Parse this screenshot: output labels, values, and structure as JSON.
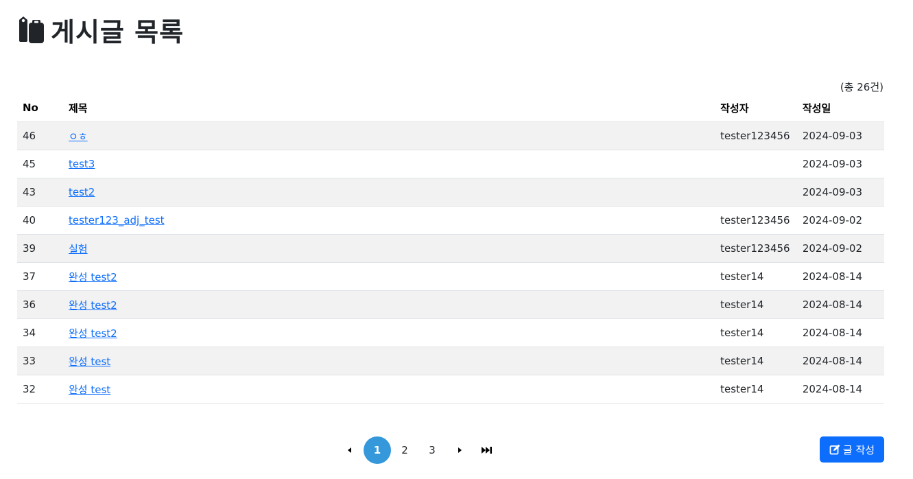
{
  "header": {
    "title": "게시글 목록",
    "icon": "clipboard-tag-icon"
  },
  "summary": {
    "total_text": "(총 26건)"
  },
  "table": {
    "columns": {
      "no": "No",
      "title": "제목",
      "writer": "작성자",
      "date": "작성일"
    },
    "rows": [
      {
        "no": "46",
        "title": "ㅇㅎ",
        "writer": "tester123456",
        "date": "2024-09-03"
      },
      {
        "no": "45",
        "title": "test3",
        "writer": "",
        "date": "2024-09-03"
      },
      {
        "no": "43",
        "title": "test2",
        "writer": "",
        "date": "2024-09-03"
      },
      {
        "no": "40",
        "title": "tester123_adj_test",
        "writer": "tester123456",
        "date": "2024-09-02"
      },
      {
        "no": "39",
        "title": "실험",
        "writer": "tester123456",
        "date": "2024-09-02"
      },
      {
        "no": "37",
        "title": "완성 test2",
        "writer": "tester14",
        "date": "2024-08-14"
      },
      {
        "no": "36",
        "title": "완성 test2",
        "writer": "tester14",
        "date": "2024-08-14"
      },
      {
        "no": "34",
        "title": "완성 test2",
        "writer": "tester14",
        "date": "2024-08-14"
      },
      {
        "no": "33",
        "title": "완성 test",
        "writer": "tester14",
        "date": "2024-08-14"
      },
      {
        "no": "32",
        "title": "완성 test",
        "writer": "tester14",
        "date": "2024-08-14"
      }
    ]
  },
  "pagination": {
    "prev_icon": "caret-left-icon",
    "pages": [
      "1",
      "2",
      "3"
    ],
    "current_page": "1",
    "next_icon": "caret-right-icon",
    "last_icon": "fast-forward-icon"
  },
  "actions": {
    "write_label": "글 작성",
    "write_icon": "edit-icon"
  },
  "colors": {
    "link": "#0d6efd",
    "active_page": "#3498db",
    "primary_button": "#0d6efd",
    "stripe": "#f2f2f2"
  }
}
